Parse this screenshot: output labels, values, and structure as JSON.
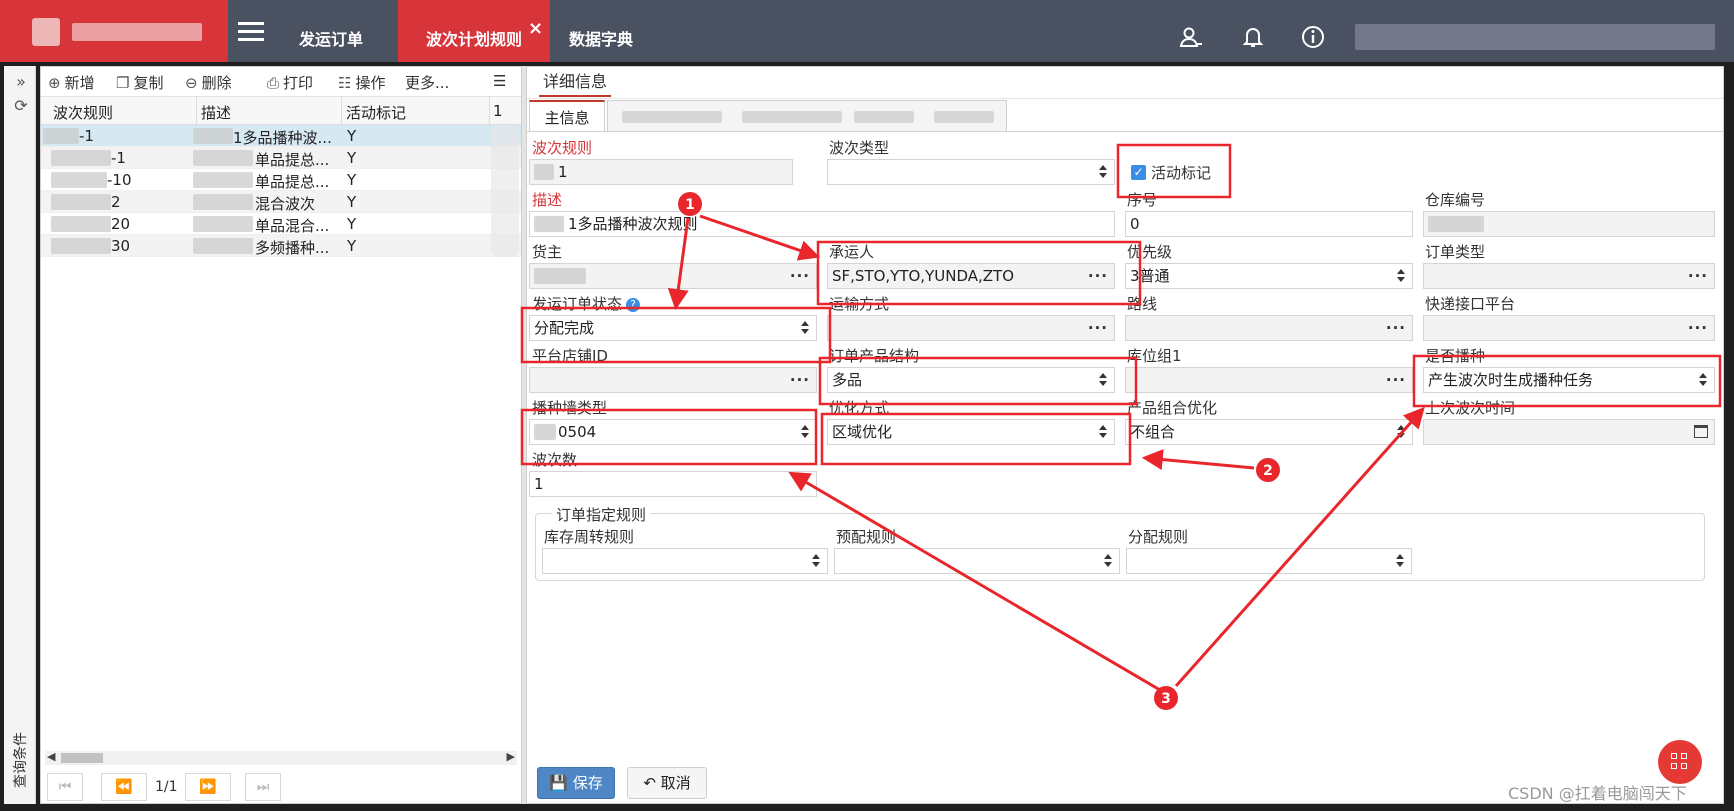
{
  "topbar": {
    "tabs": [
      {
        "label": "发运订单"
      },
      {
        "label": "波次计划规则",
        "close": "×"
      },
      {
        "label": "数据字典"
      }
    ]
  },
  "leftstrip": {
    "search_label": "查询条件"
  },
  "toolbar": {
    "add": "新增",
    "copy": "复制",
    "delete": "删除",
    "print": "打印",
    "operate": "操作",
    "more": "更多..."
  },
  "grid": {
    "columns": [
      "波次规则",
      "描述",
      "活动标记",
      "1"
    ],
    "rows": [
      {
        "rule": "-1",
        "desc": "1多品播种波...",
        "flag": "Y"
      },
      {
        "rule": "-1",
        "desc": "单品提总...",
        "flag": "Y"
      },
      {
        "rule": "-10",
        "desc": "单品提总...",
        "flag": "Y"
      },
      {
        "rule": "2",
        "desc": "混合波次",
        "flag": "Y"
      },
      {
        "rule": "20",
        "desc": "单品混合...",
        "flag": "Y"
      },
      {
        "rule": "30",
        "desc": "多频播种...",
        "flag": "Y"
      }
    ],
    "pager": "1/1"
  },
  "detail": {
    "title": "详细信息",
    "subtab_main": "主信息",
    "fields": {
      "wave_rule": {
        "label": "波次规则",
        "value": "1"
      },
      "wave_type": {
        "label": "波次类型",
        "value": ""
      },
      "active_flag": {
        "label": "活动标记",
        "check": "✓"
      },
      "desc": {
        "label": "描述",
        "value": "1多品播种波次规则"
      },
      "seq": {
        "label": "序号",
        "value": "0"
      },
      "warehouse": {
        "label": "仓库编号",
        "value": ""
      },
      "owner": {
        "label": "货主",
        "value": ""
      },
      "carrier": {
        "label": "承运人",
        "value": "SF,STO,YTO,YUNDA,ZTO"
      },
      "priority": {
        "label": "优先级",
        "value": "3普通"
      },
      "order_type": {
        "label": "订单类型",
        "value": ""
      },
      "order_status": {
        "label": "发运订单状态",
        "value": "分配完成",
        "help": "?"
      },
      "transport": {
        "label": "运输方式",
        "value": ""
      },
      "route": {
        "label": "路线",
        "value": ""
      },
      "express": {
        "label": "快递接口平台",
        "value": ""
      },
      "shop": {
        "label": "平台店铺ID",
        "value": ""
      },
      "structure": {
        "label": "订单产品结构",
        "value": "多品"
      },
      "loc_group": {
        "label": "库位组1",
        "value": ""
      },
      "sowing": {
        "label": "是否播种",
        "value": "产生波次时生成播种任务"
      },
      "wall_type": {
        "label": "播种墙类型",
        "value": "0504"
      },
      "optimize": {
        "label": "优化方式",
        "value": "区域优化"
      },
      "combine": {
        "label": "产品组合优化",
        "value": "不组合"
      },
      "last_time": {
        "label": "上次波次时间",
        "value": ""
      },
      "wave_count": {
        "label": "波次数",
        "value": "1"
      }
    },
    "order_rules": {
      "legend": "订单指定规则",
      "turnover": {
        "label": "库存周转规则",
        "value": ""
      },
      "prealloc": {
        "label": "预配规则",
        "value": ""
      },
      "alloc": {
        "label": "分配规则",
        "value": ""
      }
    },
    "buttons": {
      "save": "保存",
      "cancel": "取消"
    }
  },
  "annotations": {
    "m1": "1",
    "m2": "2",
    "m3": "3",
    "color": "#e8262b"
  },
  "watermark": "CSDN @扛着电脑闯天下"
}
